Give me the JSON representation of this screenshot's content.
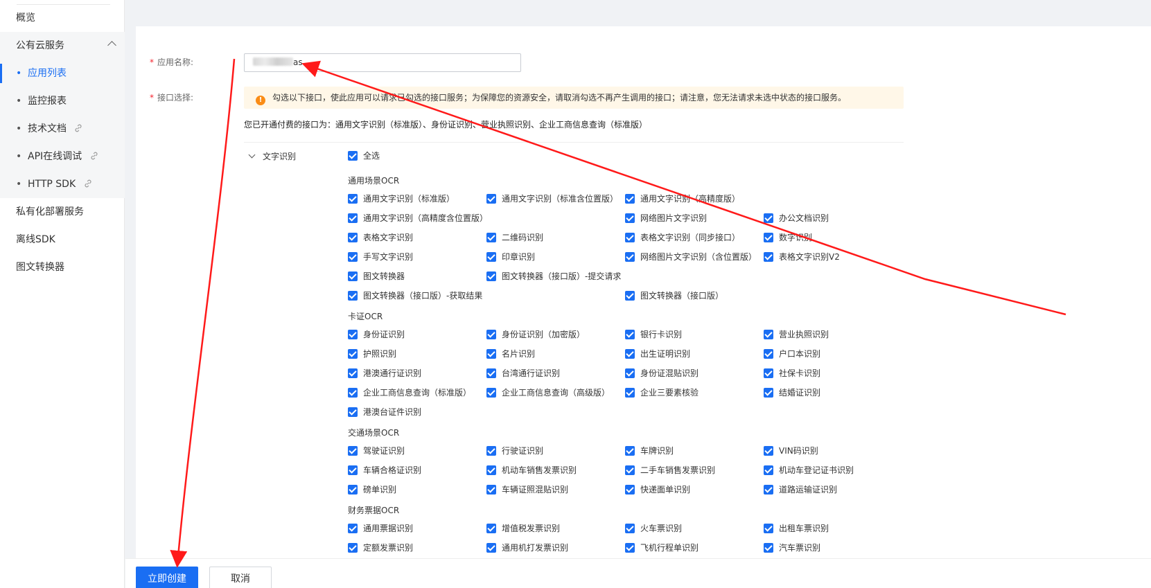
{
  "sidebar": {
    "overview": "概览",
    "public_cloud": "公有云服务",
    "app_list": "应用列表",
    "monitor": "监控报表",
    "tech_docs": "技术文档",
    "api_debug": "API在线调试",
    "http_sdk": "HTTP SDK",
    "private": "私有化部署服务",
    "offline_sdk": "离线SDK",
    "converter": "图文转换器"
  },
  "form": {
    "app_name_label": "应用名称:",
    "app_name_value_suffix": "as",
    "api_select_label": "接口选择:",
    "notice": "勾选以下接口，使此应用可以请求已勾选的接口服务；为保障您的资源安全，请取消勾选不再产生调用的接口；请注意，您无法请求未选中状态的接口服务。",
    "paid_apis": "您已开通付费的接口为：通用文字识别（标准版）、身份证识别、营业执照识别、企业工商信息查询（标准版）",
    "category": "文字识别",
    "select_all": "全选"
  },
  "groups": {
    "g1": "通用场景OCR",
    "g2": "卡证OCR",
    "g3": "交通场景OCR",
    "g4": "财务票据OCR"
  },
  "apis": {
    "a01": "通用文字识别（标准版）",
    "a02": "通用文字识别（标准含位置版）",
    "a03": "通用文字识别（高精度版）",
    "a04": "通用文字识别（高精度含位置版）",
    "a05": "网络图片文字识别",
    "a06": "办公文档识别",
    "a07": "表格文字识别",
    "a08": "二维码识别",
    "a09": "表格文字识别（同步接口）",
    "a10": "数字识别",
    "a11": "手写文字识别",
    "a12": "印章识别",
    "a13": "网络图片文字识别（含位置版）",
    "a14": "表格文字识别V2",
    "a15": "图文转换器",
    "a16": "图文转换器（接口版）-提交请求",
    "a17": "图文转换器（接口版）-获取结果",
    "a18": "图文转换器（接口版）",
    "b01": "身份证识别",
    "b02": "身份证识别（加密版）",
    "b03": "银行卡识别",
    "b04": "营业执照识别",
    "b05": "护照识别",
    "b06": "名片识别",
    "b07": "出生证明识别",
    "b08": "户口本识别",
    "b09": "港澳通行证识别",
    "b10": "台湾通行证识别",
    "b11": "身份证混贴识别",
    "b12": "社保卡识别",
    "b13": "企业工商信息查询（标准版）",
    "b14": "企业工商信息查询（高级版）",
    "b15": "企业三要素核验",
    "b16": "结婚证识别",
    "b17": "港澳台证件识别",
    "c01": "驾驶证识别",
    "c02": "行驶证识别",
    "c03": "车牌识别",
    "c04": "VIN码识别",
    "c05": "车辆合格证识别",
    "c06": "机动车销售发票识别",
    "c07": "二手车销售发票识别",
    "c08": "机动车登记证书识别",
    "c09": "磅单识别",
    "c10": "车辆证照混贴识别",
    "c11": "快递面单识别",
    "c12": "道路运输证识别",
    "d01": "通用票据识别",
    "d02": "增值税发票识别",
    "d03": "火车票识别",
    "d04": "出租车票识别",
    "d05": "定额发票识别",
    "d06": "通用机打发票识别",
    "d07": "飞机行程单识别",
    "d08": "汽车票识别"
  },
  "footer": {
    "create": "立即创建",
    "cancel": "取消"
  },
  "colors": {
    "primary": "#1a6ef3",
    "annotation_arrow": "#ff1a1a",
    "notice_bg": "#fff7e8",
    "warn": "#fa8c16"
  }
}
